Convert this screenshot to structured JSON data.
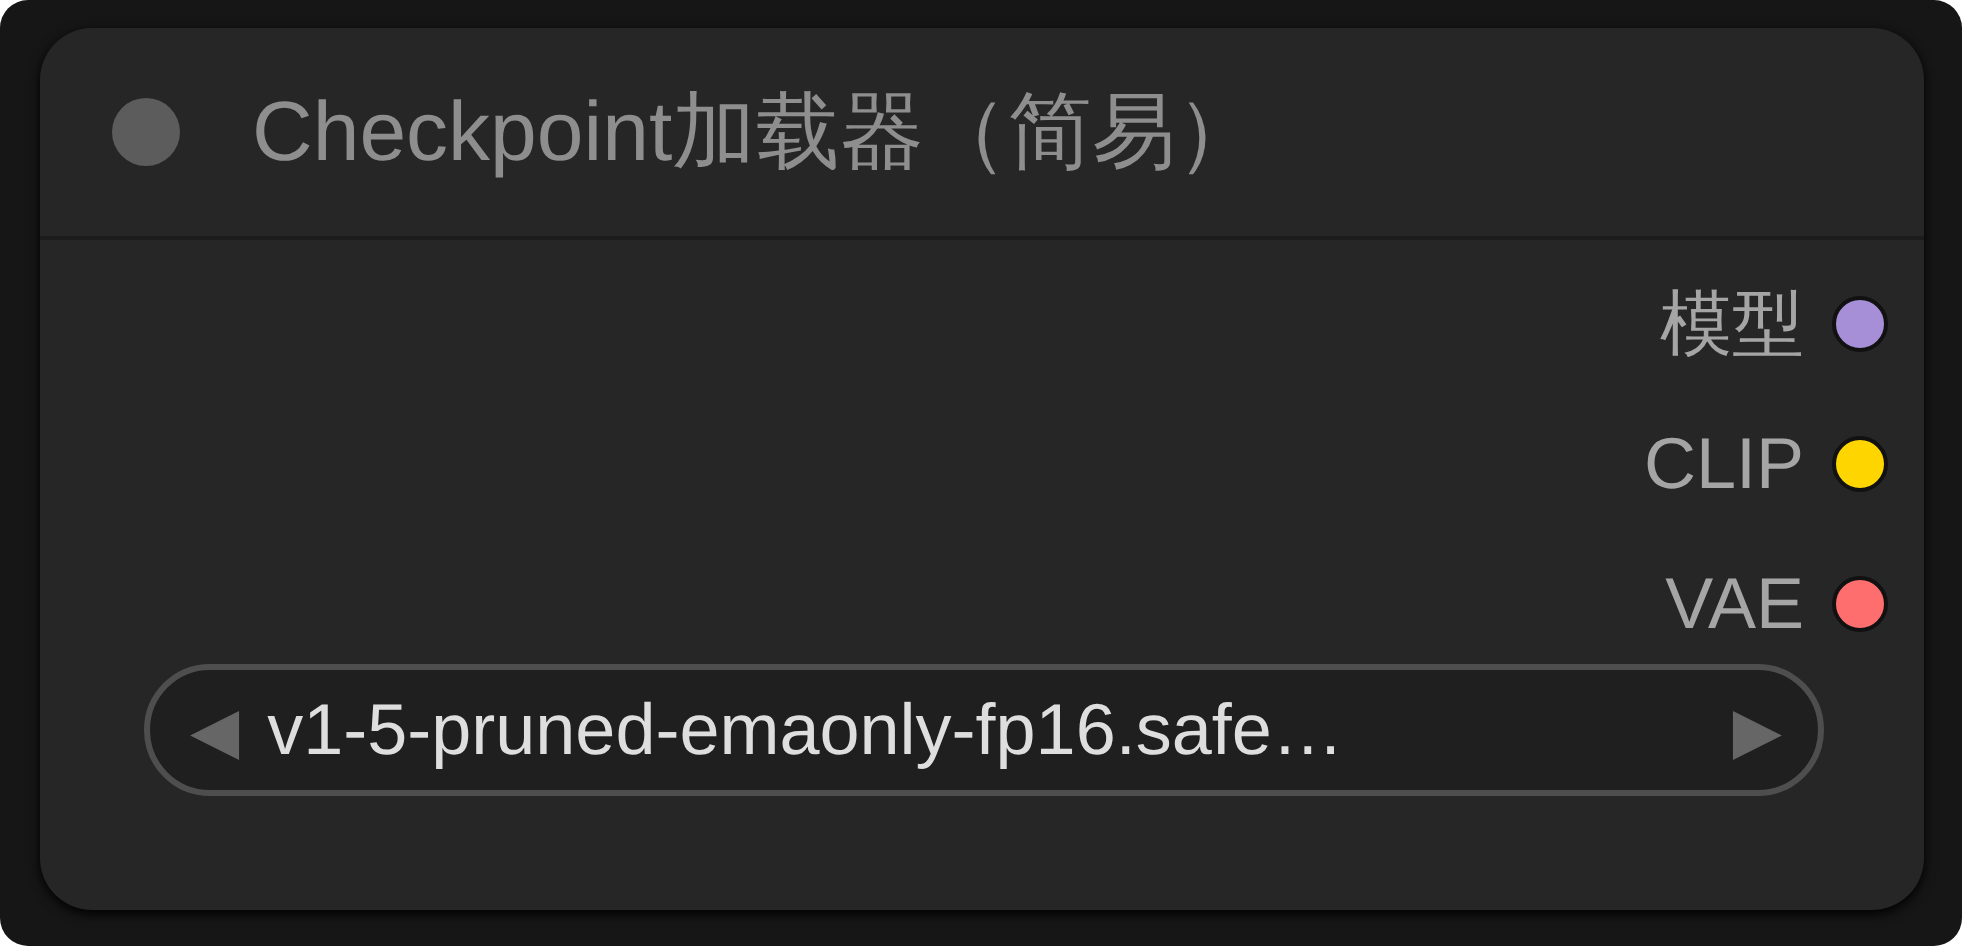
{
  "node": {
    "title": "Checkpoint加载器（简易）",
    "outputs": [
      {
        "label": "模型",
        "color": "#a78fd8"
      },
      {
        "label": "CLIP",
        "color": "#ffd500"
      },
      {
        "label": "VAE",
        "color": "#ff6e6e"
      }
    ],
    "widget": {
      "value": "v1-5-pruned-emaonly-fp16.safe…",
      "prev": "◀",
      "next": "▶"
    }
  }
}
